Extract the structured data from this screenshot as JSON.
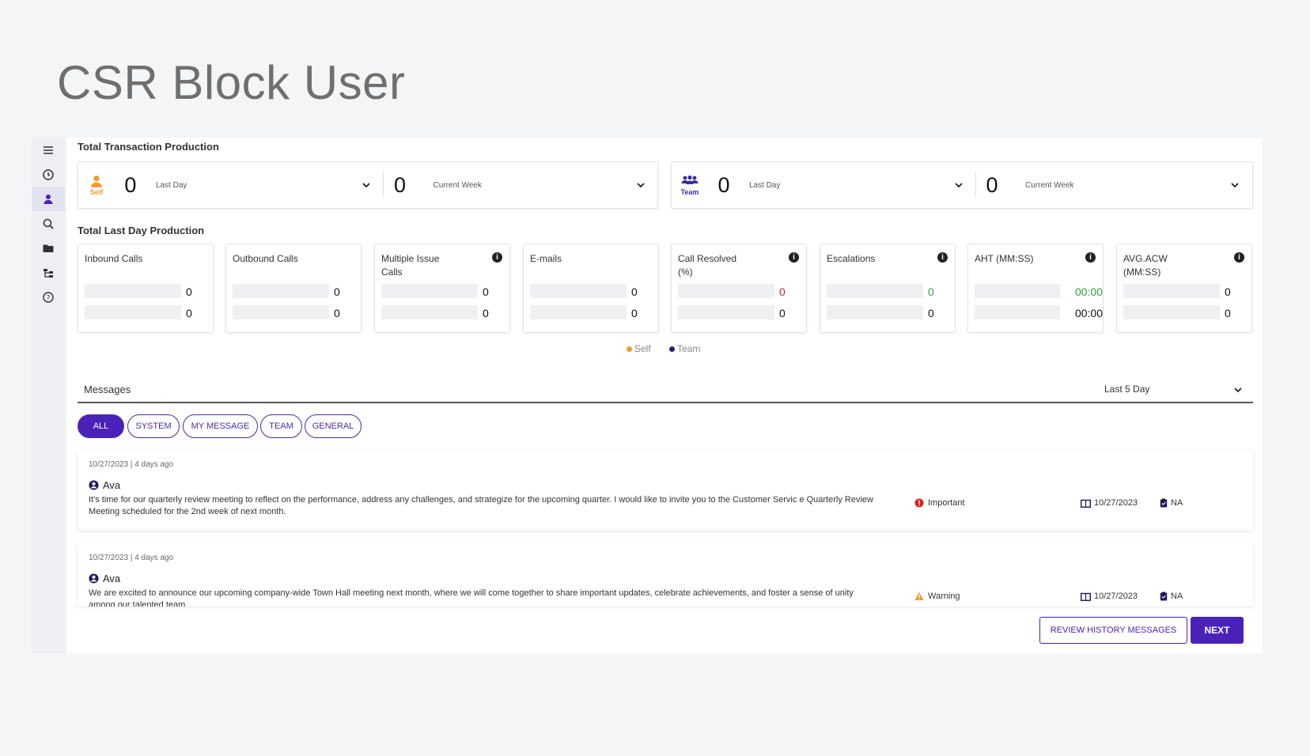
{
  "slide": {
    "title": "CSR Block User"
  },
  "sections": {
    "total_transaction": "Total Transaction Production",
    "total_last_day": "Total Last Day Production"
  },
  "self_prod": {
    "label": "Self",
    "last_day_value": "0",
    "last_day_label": "Last Day",
    "week_value": "0",
    "week_label": "Current Week"
  },
  "team_prod": {
    "label": "Team",
    "last_day_value": "0",
    "last_day_label": "Last Day",
    "week_value": "0",
    "week_label": "Current Week"
  },
  "stats": [
    {
      "title": "Inbound Calls",
      "self": "0",
      "team": "0",
      "info": false
    },
    {
      "title": "Outbound Calls",
      "self": "0",
      "team": "0",
      "info": false
    },
    {
      "title": "Multiple Issue Calls",
      "self": "0",
      "team": "0",
      "info": true
    },
    {
      "title": "E-mails",
      "self": "0",
      "team": "0",
      "info": false
    },
    {
      "title": "Call Resolved (%)",
      "self": "0",
      "team": "0",
      "info": true,
      "self_color": "#e02020"
    },
    {
      "title": "Escalations",
      "self": "0",
      "team": "0",
      "info": true,
      "self_color": "#2ca540"
    },
    {
      "title": "AHT (MM:SS)",
      "self": "00:00",
      "team": "00:00",
      "info": true,
      "self_color": "#2ca540"
    },
    {
      "title": "AVG.ACW (MM:SS)",
      "self": "0",
      "team": "0",
      "info": true
    }
  ],
  "legend": {
    "self": "Self",
    "team": "Team",
    "self_color": "#f39a2c",
    "team_color": "#2b1a7a"
  },
  "messages": {
    "label": "Messages",
    "range": "Last 5 Day",
    "filters": [
      "ALL",
      "SYSTEM",
      "MY MESSAGE",
      "TEAM",
      "GENERAL"
    ],
    "items": [
      {
        "date": "10/27/2023 | 4 days ago",
        "user": "Ava",
        "body": "It's time for our quarterly review meeting to reflect on the performance, address any challenges, and strategize for the upcoming quarter. I would like to invite you to the Customer Servic e Quarterly Review Meeting scheduled for the 2nd week of next month.",
        "priority": "Important",
        "priority_color": "#e02020",
        "msg_date": "10/27/2023",
        "na": "NA"
      },
      {
        "date": "10/27/2023 | 4 days ago",
        "user": "Ava",
        "body": "We are excited to announce our upcoming company-wide Town Hall meeting next month, where we will come together to share important updates, celebrate achievements, and foster a sense of unity among our talented team.",
        "priority": "Warning",
        "priority_color": "#f39a2c",
        "msg_date": "10/27/2023",
        "na": "NA"
      }
    ]
  },
  "buttons": {
    "review": "REVIEW HISTORY MESSAGES",
    "next": "NEXT"
  },
  "colors": {
    "accent": "#4a22ba",
    "self": "#f39a2c",
    "team": "#3b2ba0"
  }
}
